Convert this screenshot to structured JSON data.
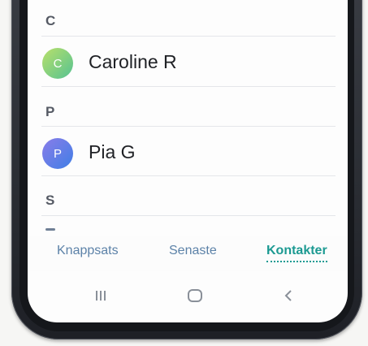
{
  "sections": [
    {
      "letter": "C",
      "contact": {
        "initial": "C",
        "name": "Caroline R"
      }
    },
    {
      "letter": "P",
      "contact": {
        "initial": "P",
        "name": "Pia G"
      }
    },
    {
      "letter": "S"
    }
  ],
  "tabs": [
    {
      "label": "Knappsats",
      "active": false
    },
    {
      "label": "Senaste",
      "active": false
    },
    {
      "label": "Kontakter",
      "active": true
    }
  ],
  "navigation": [
    "recent-apps-icon",
    "home-icon",
    "back-icon"
  ],
  "colors": {
    "accent": "#1c9a92",
    "tab_inactive": "#5c82a8",
    "avatar_c": "#7fd07d",
    "avatar_p": "#5a7fe6"
  }
}
